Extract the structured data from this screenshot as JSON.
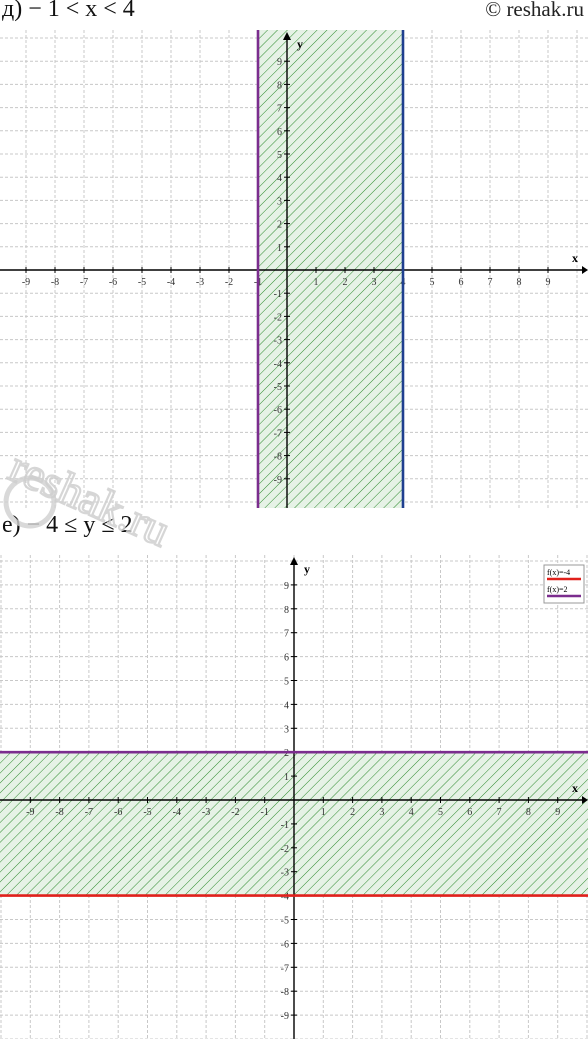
{
  "copyright": "© reshak.ru",
  "watermark": "reshak.ru",
  "panels": {
    "d": {
      "caption": "д) − 1 < x < 4"
    },
    "e": {
      "caption": "е) − 4 ≤ y ≤ 2"
    }
  },
  "chart_data": [
    {
      "type": "diagram",
      "caption": "д) − 1 < x < 4",
      "xlabel": "x",
      "ylabel": "y",
      "xlim": [
        -10,
        10
      ],
      "ylim": [
        -10,
        10
      ],
      "xticks": [
        -9,
        -8,
        -7,
        -6,
        -5,
        -4,
        -3,
        -2,
        -1,
        1,
        2,
        3,
        4,
        5,
        6,
        7,
        8,
        9
      ],
      "yticks": [
        9,
        8,
        7,
        6,
        5,
        4,
        3,
        2,
        1,
        -1,
        -2,
        -3,
        -4,
        -5,
        -6,
        -7,
        -8,
        -9
      ],
      "grid": true,
      "boundaries": [
        {
          "kind": "vertical",
          "x": -1,
          "color": "#7b2d8e"
        },
        {
          "kind": "vertical",
          "x": 4,
          "color": "#1f3f8f"
        }
      ],
      "shaded_region": {
        "x_from": -1,
        "x_to": 4,
        "hatch_color": "#2e8b2e",
        "fill": "#e6f2e6"
      }
    },
    {
      "type": "diagram",
      "caption": "е) − 4 ≤ y ≤ 2",
      "xlabel": "x",
      "ylabel": "y",
      "xlim": [
        -10,
        10
      ],
      "ylim": [
        -10,
        10
      ],
      "xticks": [
        -9,
        -8,
        -7,
        -6,
        -5,
        -4,
        -3,
        -2,
        -1,
        1,
        2,
        3,
        4,
        5,
        6,
        7,
        8,
        9
      ],
      "yticks": [
        9,
        8,
        7,
        6,
        5,
        4,
        3,
        2,
        1,
        -1,
        -2,
        -3,
        -4,
        -5,
        -6,
        -7,
        -8,
        -9
      ],
      "grid": true,
      "boundaries": [
        {
          "kind": "horizontal",
          "y": 2,
          "color": "#7b2d8e",
          "label": "f(x)=2"
        },
        {
          "kind": "horizontal",
          "y": -4,
          "color": "#e0201b",
          "label": "f(x)=-4"
        }
      ],
      "legend": {
        "placement": "top-right",
        "entries": [
          {
            "label": "f(x)=-4",
            "color": "#e0201b"
          },
          {
            "label": "f(x)=2",
            "color": "#7b2d8e"
          }
        ]
      },
      "shaded_region": {
        "y_from": -4,
        "y_to": 2,
        "hatch_color": "#2e8b2e",
        "fill": "#e6f2e6"
      }
    }
  ]
}
